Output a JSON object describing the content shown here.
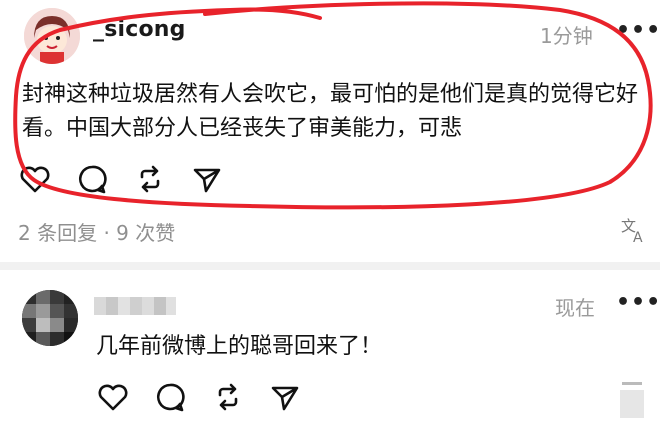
{
  "post1": {
    "username": "_sicong",
    "time": "1分钟",
    "body": "封神这种垃圾居然有人会吹它，最可怕的是他们是真的觉得它好看。中国大部分人已经丧失了审美能力，可悲",
    "stats": "2 条回复 · 9 次赞",
    "more": "•••"
  },
  "post2": {
    "time": "现在",
    "body": "几年前微博上的聪哥回来了！",
    "more": "•••"
  },
  "icons": [
    "heart-icon",
    "comment-icon",
    "repost-icon",
    "share-icon",
    "translate-icon"
  ],
  "colors": {
    "annotation": "#e8232b",
    "meta": "#9a9a9a"
  }
}
